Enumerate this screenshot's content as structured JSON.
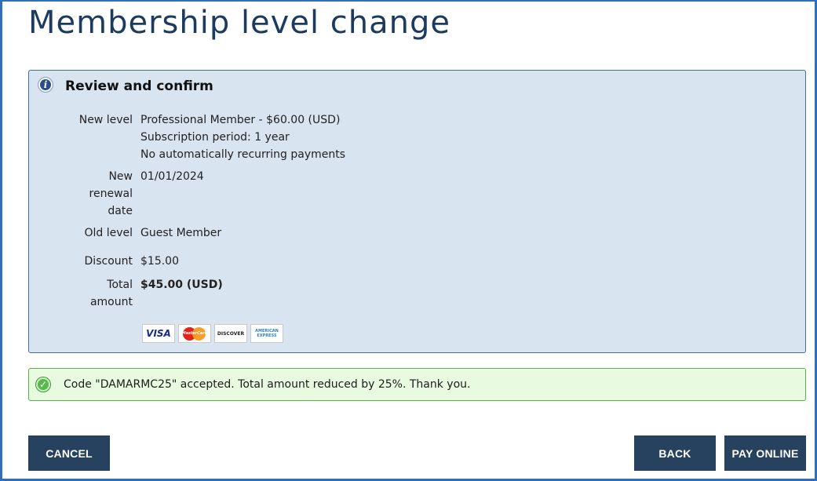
{
  "page": {
    "title": "Membership level change"
  },
  "review": {
    "title": "Review and confirm",
    "new_level_label": "New level",
    "new_level_lines": [
      "Professional Member - $60.00 (USD)",
      "Subscription period: 1 year",
      "No automatically recurring payments"
    ],
    "renewal_label_lines": [
      "New",
      "renewal",
      "date"
    ],
    "renewal_value": "01/01/2024",
    "old_level_label": "Old level",
    "old_level_value": "Guest Member",
    "discount_label": "Discount",
    "discount_value": "$15.00",
    "total_label_lines": [
      "Total",
      "amount"
    ],
    "total_value": "$45.00 (USD)",
    "cards": {
      "visa": "VISA",
      "mastercard": "MasterCard",
      "discover": "DISCOVER",
      "amex_lines": [
        "AMERICAN",
        "EXPRESS"
      ]
    }
  },
  "success": {
    "message": "Code \"DAMARMC25\" accepted. Total amount reduced by 25%. Thank you."
  },
  "buttons": {
    "cancel": "CANCEL",
    "back": "BACK",
    "pay_online": "PAY ONLINE"
  },
  "colors": {
    "accent": "#2f6fb6",
    "button": "#27425f",
    "review_bg": "#d9e4f1",
    "success_bg": "#e8fbe0"
  },
  "icons": {
    "info": "info-icon",
    "success": "check-circle-icon"
  }
}
